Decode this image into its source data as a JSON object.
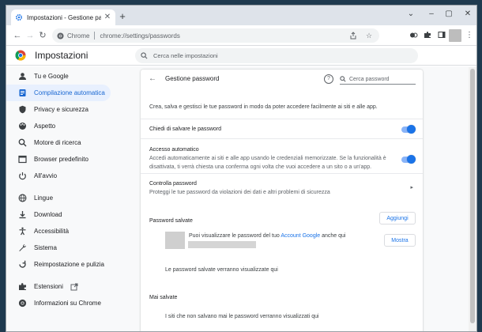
{
  "tab": {
    "title": "Impostazioni - Gestione passwo"
  },
  "window_controls": {
    "chevron": "⌄",
    "minimize": "–",
    "restore": "▢",
    "close": "✕"
  },
  "toolbar": {
    "site_label": "Chrome",
    "url": "chrome://settings/passwords"
  },
  "header": {
    "app_title": "Impostazioni",
    "search_placeholder": "Cerca nelle impostazioni"
  },
  "sidebar": {
    "items": [
      {
        "label": "Tu e Google",
        "icon": "person-icon"
      },
      {
        "label": "Compilazione automatica",
        "icon": "autofill-icon",
        "active": true
      },
      {
        "label": "Privacy e sicurezza",
        "icon": "shield-icon"
      },
      {
        "label": "Aspetto",
        "icon": "palette-icon"
      },
      {
        "label": "Motore di ricerca",
        "icon": "search-icon"
      },
      {
        "label": "Browser predefinito",
        "icon": "browser-icon"
      },
      {
        "label": "All'avvio",
        "icon": "power-icon"
      },
      {
        "label": "Lingue",
        "icon": "globe-icon"
      },
      {
        "label": "Download",
        "icon": "download-icon"
      },
      {
        "label": "Accessibilità",
        "icon": "accessibility-icon"
      },
      {
        "label": "Sistema",
        "icon": "wrench-icon"
      },
      {
        "label": "Reimpostazione e pulizia",
        "icon": "reset-icon"
      },
      {
        "label": "Estensioni",
        "icon": "puzzle-icon"
      },
      {
        "label": "Informazioni su Chrome",
        "icon": "chrome-icon"
      }
    ]
  },
  "card": {
    "title": "Gestione password",
    "search_placeholder": "Cerca password",
    "intro": "Crea, salva e gestisci le tue password in modo da poter accedere facilmente ai siti e alle app.",
    "offer_save": {
      "label": "Chiedi di salvare le password",
      "enabled": true
    },
    "auto_signin": {
      "title": "Accesso automatico",
      "description": "Accedi automaticamente ai siti e alle app usando le credenziali memorizzate. Se la funzionalità è disattivata, ti verrà chiesta una conferma ogni volta che vuoi accedere a un sito o a un'app.",
      "enabled": true
    },
    "check": {
      "title": "Controlla password",
      "description": "Proteggi le tue password da violazioni dei dati e altri problemi di sicurezza"
    },
    "saved": {
      "title": "Password salvate",
      "add_button": "Aggiungi",
      "account_prefix": "Puoi visualizzare le password del tuo ",
      "account_link": "Account Google",
      "account_suffix": " anche qui",
      "show_button": "Mostra",
      "empty": "Le password salvate verranno visualizzate qui"
    },
    "never": {
      "title": "Mai salvate",
      "empty": "I siti che non salvano mai le password verranno visualizzati qui"
    }
  },
  "colors": {
    "accent": "#1a73e8",
    "active_bg": "#e8f0fe",
    "chrome_red": "#db4437",
    "chrome_green": "#0f9d58",
    "chrome_yellow": "#f4b400"
  }
}
